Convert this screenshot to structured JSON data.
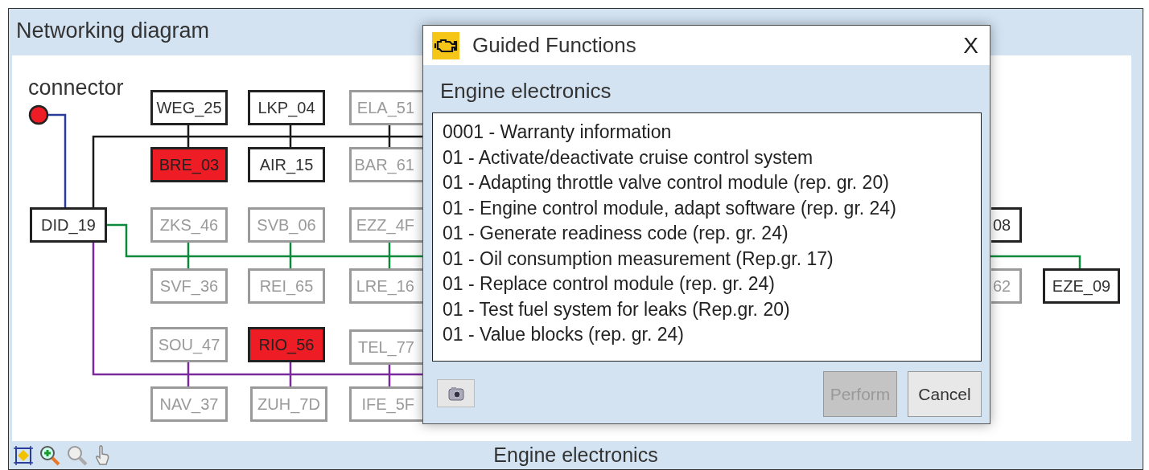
{
  "window": {
    "title": "Networking diagram"
  },
  "diagram": {
    "connector_label": "connector",
    "nodes": [
      {
        "label": "WEG_25",
        "kind": "normal"
      },
      {
        "label": "LKP_04",
        "kind": "normal"
      },
      {
        "label": "ELA_51",
        "kind": "inactive"
      },
      {
        "label": "BRE_03",
        "kind": "fault"
      },
      {
        "label": "AIR_15",
        "kind": "normal"
      },
      {
        "label": "BAR_61",
        "kind": "inactive"
      },
      {
        "label": "DID_19",
        "kind": "normal"
      },
      {
        "label": "ZKS_46",
        "kind": "inactive"
      },
      {
        "label": "SVB_06",
        "kind": "inactive"
      },
      {
        "label": "EZZ_4F",
        "kind": "inactive"
      },
      {
        "label": "08",
        "kind": "normal"
      },
      {
        "label": "SVF_36",
        "kind": "inactive"
      },
      {
        "label": "REI_65",
        "kind": "inactive"
      },
      {
        "label": "LRE_16",
        "kind": "inactive"
      },
      {
        "label": "62",
        "kind": "inactive"
      },
      {
        "label": "EZE_09",
        "kind": "normal"
      },
      {
        "label": "SOU_47",
        "kind": "inactive"
      },
      {
        "label": "RIO_56",
        "kind": "fault"
      },
      {
        "label": "TEL_77",
        "kind": "inactive"
      },
      {
        "label": "NAV_37",
        "kind": "inactive"
      },
      {
        "label": "ZUH_7D",
        "kind": "inactive"
      },
      {
        "label": "IFE_5F",
        "kind": "inactive"
      }
    ]
  },
  "dialog": {
    "title": "Guided Functions",
    "close": "X",
    "section": "Engine electronics",
    "items": [
      "0001 - Warranty information",
      "01 - Activate/deactivate cruise control system",
      "01 - Adapting throttle valve control module (rep. gr. 20)",
      "01 - Engine control module, adapt software (rep. gr. 24)",
      "01 - Generate readiness code (rep. gr. 24)",
      "01 - Oil consumption measurement (Rep.gr. 17)",
      "01 - Replace control module (rep. gr. 24)",
      "01 - Test fuel system for leaks (Rep.gr. 20)",
      "01 - Value blocks (rep. gr. 24)"
    ],
    "buttons": [
      {
        "label": "Perform",
        "disabled": true
      },
      {
        "label": "Cancel",
        "disabled": false
      }
    ]
  },
  "status_bar": {
    "text": "Engine electronics"
  }
}
